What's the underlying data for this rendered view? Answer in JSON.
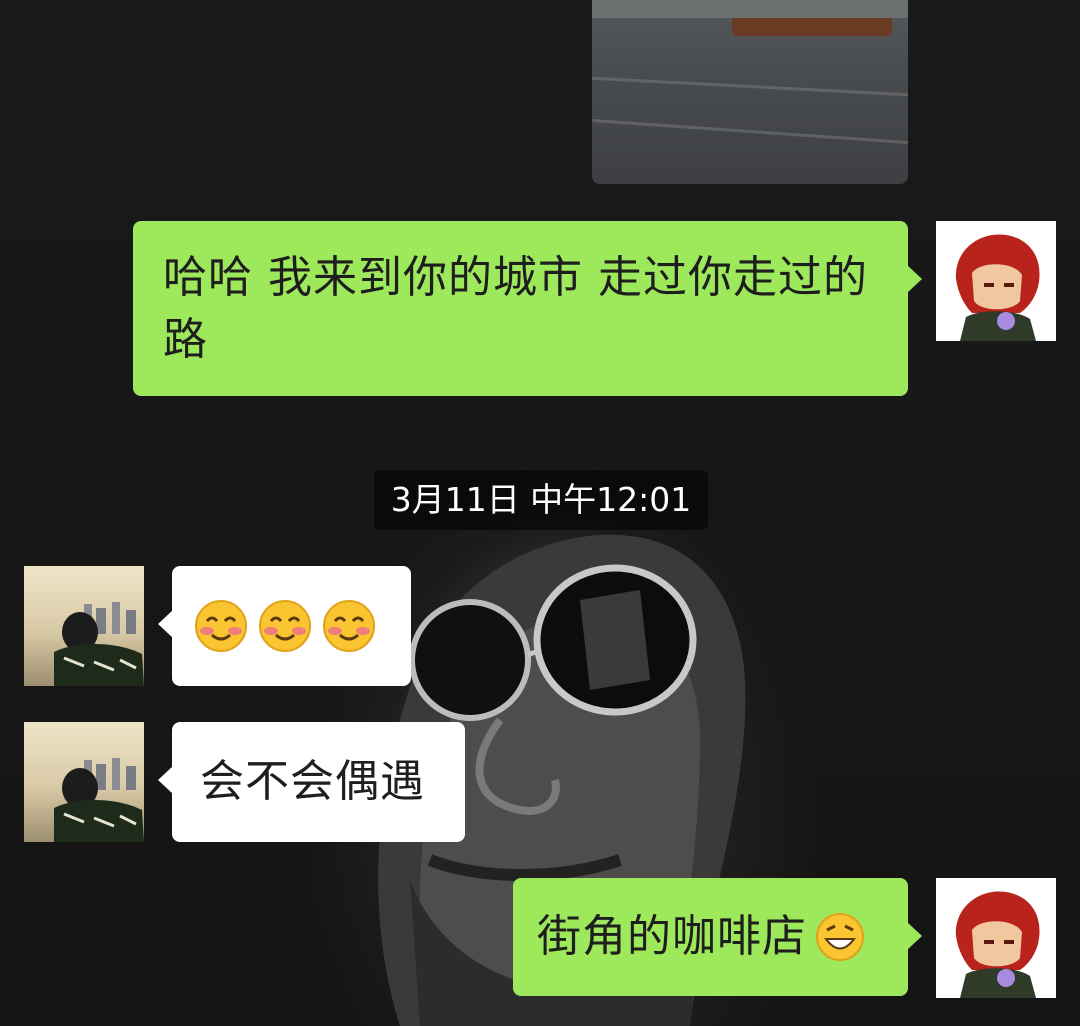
{
  "chat": {
    "messages": [
      {
        "from": "me",
        "type": "image"
      },
      {
        "from": "me",
        "type": "text",
        "text": "哈哈 我来到你的城市 走过你走过的路"
      },
      {
        "type": "timestamp",
        "text": "3月11日 中午12:01"
      },
      {
        "from": "them",
        "type": "emoji",
        "emojis": [
          "blush-emoji",
          "blush-emoji",
          "blush-emoji"
        ]
      },
      {
        "from": "them",
        "type": "text",
        "text": "会不会偶遇"
      },
      {
        "from": "me",
        "type": "text",
        "text": "街角的咖啡店",
        "trailing_emoji": "grin-emoji"
      }
    ]
  },
  "colors": {
    "sent_bubble": "#9de85b",
    "received_bubble": "#ffffff",
    "timestamp_bg": "#000000",
    "background": "#151515"
  }
}
